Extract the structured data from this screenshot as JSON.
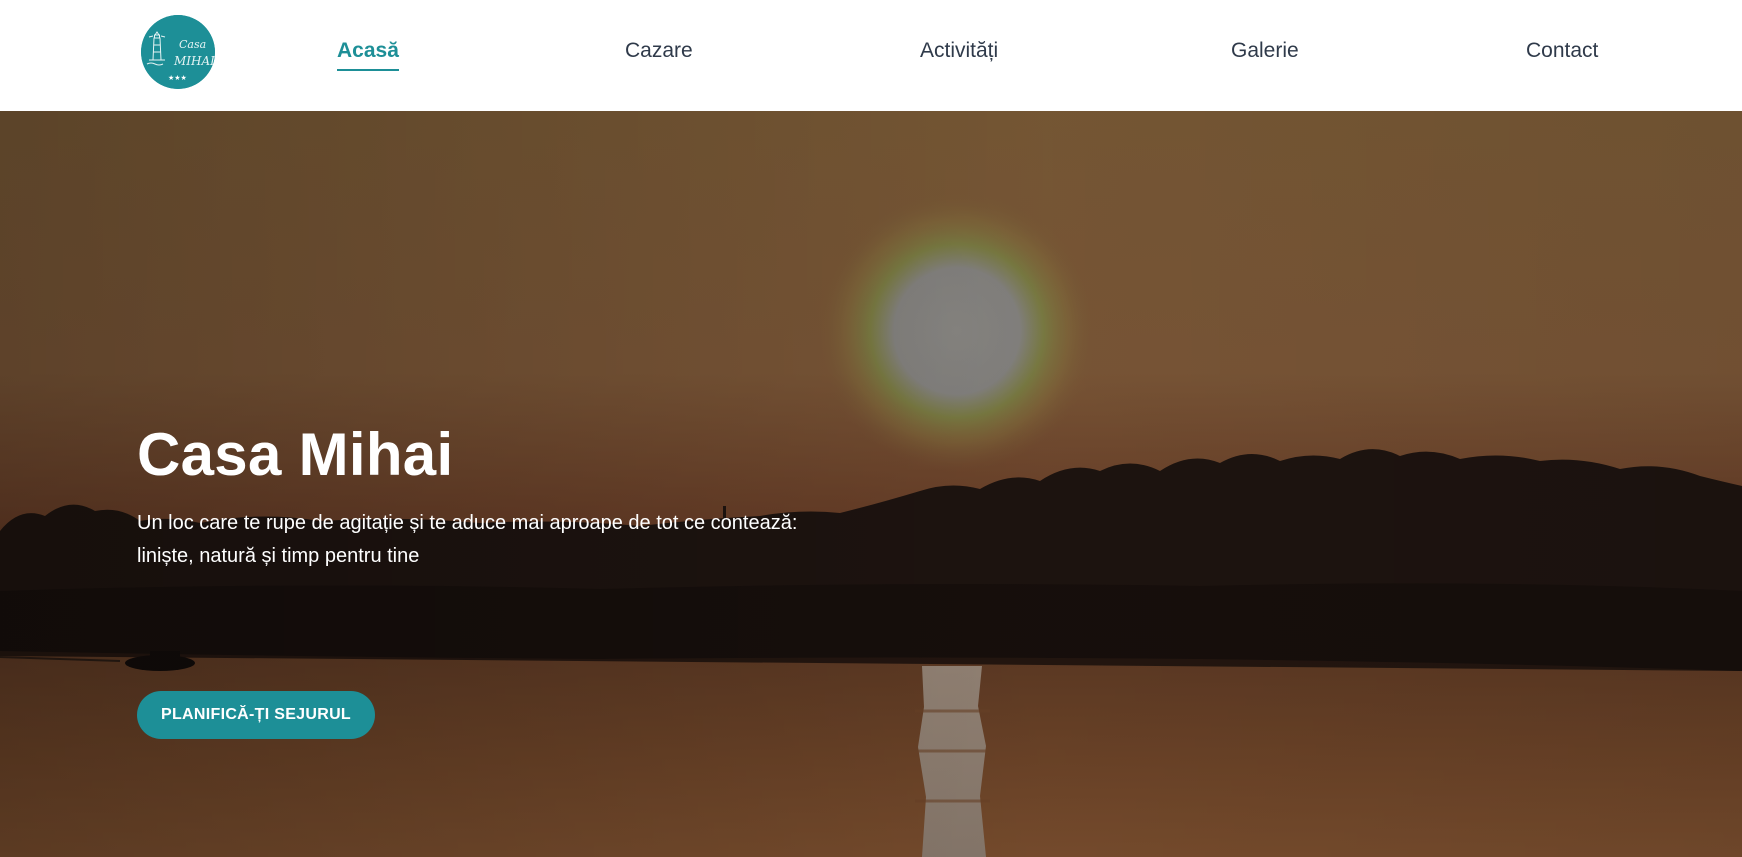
{
  "brand": {
    "logo_text_line1": "Casa",
    "logo_text_line2": "MIHAI",
    "logo_stars": "★★★",
    "accent_color": "#1d8f97"
  },
  "nav": {
    "items": [
      {
        "label": "Acasă",
        "active": true
      },
      {
        "label": "Cazare",
        "active": false
      },
      {
        "label": "Activități",
        "active": false
      },
      {
        "label": "Galerie",
        "active": false
      },
      {
        "label": "Contact",
        "active": false
      }
    ]
  },
  "hero": {
    "title": "Casa Mihai",
    "subtitle": "Un loc care te rupe de agitație și te aduce mai aproape de tot ce contează: liniște, natură și timp pentru tine",
    "cta_label": "PLANIFICĂ-ȚI SEJURUL",
    "background": "sunset-over-river"
  }
}
